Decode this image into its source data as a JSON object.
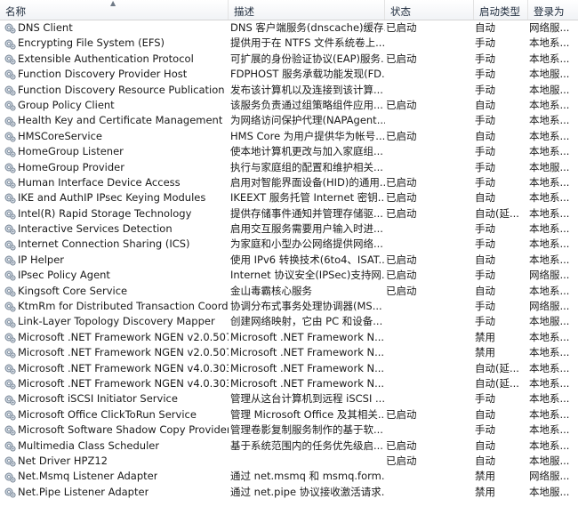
{
  "columns": {
    "name": "名称",
    "description": "描述",
    "status": "状态",
    "startup_type": "启动类型",
    "log_on_as": "登录为"
  },
  "sort_indicator": "▲",
  "services": [
    {
      "name": "DNS Client",
      "description": "DNS 客户端服务(dnscache)缓存...",
      "status": "已启动",
      "startup": "自动",
      "logon": "网络服..."
    },
    {
      "name": "Encrypting File System (EFS)",
      "description": "提供用于在 NTFS 文件系统卷上...",
      "status": "",
      "startup": "手动",
      "logon": "本地系..."
    },
    {
      "name": "Extensible Authentication Protocol",
      "description": "可扩展的身份验证协议(EAP)服务...",
      "status": "已启动",
      "startup": "手动",
      "logon": "本地系..."
    },
    {
      "name": "Function Discovery Provider Host",
      "description": "FDPHOST 服务承载功能发现(FD...",
      "status": "",
      "startup": "手动",
      "logon": "本地服..."
    },
    {
      "name": "Function Discovery Resource Publication",
      "description": "发布该计算机以及连接到该计算...",
      "status": "",
      "startup": "手动",
      "logon": "本地服..."
    },
    {
      "name": "Group Policy Client",
      "description": "该服务负责通过组策略组件应用...",
      "status": "已启动",
      "startup": "自动",
      "logon": "本地系..."
    },
    {
      "name": "Health Key and Certificate Management",
      "description": "为网络访问保护代理(NAPAgent...",
      "status": "",
      "startup": "手动",
      "logon": "本地系..."
    },
    {
      "name": "HMSCoreService",
      "description": "HMS Core 为用户提供华为帐号...",
      "status": "已启动",
      "startup": "自动",
      "logon": "本地系..."
    },
    {
      "name": "HomeGroup Listener",
      "description": "使本地计算机更改与加入家庭组...",
      "status": "",
      "startup": "手动",
      "logon": "本地系..."
    },
    {
      "name": "HomeGroup Provider",
      "description": "执行与家庭组的配置和维护相关...",
      "status": "",
      "startup": "手动",
      "logon": "本地服..."
    },
    {
      "name": "Human Interface Device Access",
      "description": "启用对智能界面设备(HID)的通用...",
      "status": "已启动",
      "startup": "手动",
      "logon": "本地系..."
    },
    {
      "name": "IKE and AuthIP IPsec Keying Modules",
      "description": "IKEEXT 服务托管 Internet 密钥...",
      "status": "已启动",
      "startup": "自动",
      "logon": "本地系..."
    },
    {
      "name": "Intel(R) Rapid Storage Technology",
      "description": "提供存储事件通知并管理存储驱...",
      "status": "已启动",
      "startup": "自动(延...",
      "logon": "本地系..."
    },
    {
      "name": "Interactive Services Detection",
      "description": "启用交互服务需要用户输入时进...",
      "status": "",
      "startup": "手动",
      "logon": "本地系..."
    },
    {
      "name": "Internet Connection Sharing (ICS)",
      "description": "为家庭和小型办公网络提供网络...",
      "status": "",
      "startup": "手动",
      "logon": "本地系..."
    },
    {
      "name": "IP Helper",
      "description": "使用 IPv6 转换技术(6to4、ISAT...",
      "status": "已启动",
      "startup": "自动",
      "logon": "本地系..."
    },
    {
      "name": "IPsec Policy Agent",
      "description": "Internet 协议安全(IPSec)支持网...",
      "status": "已启动",
      "startup": "手动",
      "logon": "网络服..."
    },
    {
      "name": "Kingsoft Core Service",
      "description": "金山毒霸核心服务",
      "status": "已启动",
      "startup": "自动",
      "logon": "本地系..."
    },
    {
      "name": "KtmRm for Distributed Transaction Coordi...",
      "description": "协调分布式事务处理协调器(MS...",
      "status": "",
      "startup": "手动",
      "logon": "网络服..."
    },
    {
      "name": "Link-Layer Topology Discovery Mapper",
      "description": "创建网络映射，它由 PC 和设备...",
      "status": "",
      "startup": "手动",
      "logon": "本地服..."
    },
    {
      "name": "Microsoft .NET Framework NGEN v2.0.507...",
      "description": "Microsoft .NET Framework N...",
      "status": "",
      "startup": "禁用",
      "logon": "本地系..."
    },
    {
      "name": "Microsoft .NET Framework NGEN v2.0.507...",
      "description": "Microsoft .NET Framework N...",
      "status": "",
      "startup": "禁用",
      "logon": "本地系..."
    },
    {
      "name": "Microsoft .NET Framework NGEN v4.0.303...",
      "description": "Microsoft .NET Framework N...",
      "status": "",
      "startup": "自动(延...",
      "logon": "本地系..."
    },
    {
      "name": "Microsoft .NET Framework NGEN v4.0.303...",
      "description": "Microsoft .NET Framework N...",
      "status": "",
      "startup": "自动(延...",
      "logon": "本地系..."
    },
    {
      "name": "Microsoft iSCSI Initiator Service",
      "description": "管理从这台计算机到远程 iSCSI ...",
      "status": "",
      "startup": "手动",
      "logon": "本地系..."
    },
    {
      "name": "Microsoft Office ClickToRun Service",
      "description": "管理 Microsoft Office 及其相关...",
      "status": "已启动",
      "startup": "自动",
      "logon": "本地系..."
    },
    {
      "name": "Microsoft Software Shadow Copy Provider",
      "description": "管理卷影复制服务制作的基于软...",
      "status": "",
      "startup": "手动",
      "logon": "本地系..."
    },
    {
      "name": "Multimedia Class Scheduler",
      "description": "基于系统范围内的任务优先级启...",
      "status": "已启动",
      "startup": "自动",
      "logon": "本地系..."
    },
    {
      "name": "Net Driver HPZ12",
      "description": "",
      "status": "已启动",
      "startup": "自动",
      "logon": "本地服..."
    },
    {
      "name": "Net.Msmq Listener Adapter",
      "description": "通过 net.msmq 和 msmq.form...",
      "status": "",
      "startup": "禁用",
      "logon": "网络服..."
    },
    {
      "name": "Net.Pipe Listener Adapter",
      "description": "通过 net.pipe 协议接收激活请求...",
      "status": "",
      "startup": "禁用",
      "logon": "本地服..."
    }
  ]
}
